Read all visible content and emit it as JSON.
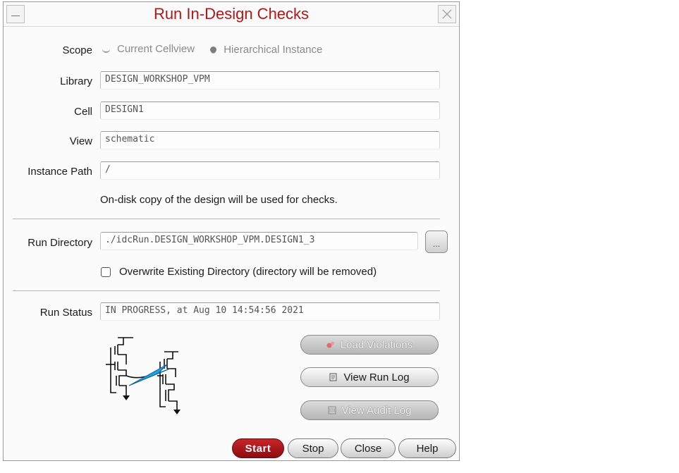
{
  "window": {
    "title": "Run In-Design Checks"
  },
  "scope": {
    "label": "Scope",
    "options": [
      {
        "label": "Current Cellview",
        "selected": false
      },
      {
        "label": "Hierarchical Instance",
        "selected": true
      }
    ]
  },
  "library": {
    "label": "Library",
    "value": "DESIGN_WORKSHOP_VPM"
  },
  "cell": {
    "label": "Cell",
    "value": "DESIGN1"
  },
  "view": {
    "label": "View",
    "value": "schematic"
  },
  "instance_path": {
    "label": "Instance Path",
    "value": "/"
  },
  "note": "On-disk copy of the design will be used for checks.",
  "run_directory": {
    "label": "Run Directory",
    "value": "./idcRun.DESIGN_WORKSHOP_VPM.DESIGN1_3",
    "browse_label": "..."
  },
  "overwrite": {
    "label": "Overwrite Existing Directory (directory will be removed)",
    "checked": false
  },
  "run_status": {
    "label": "Run Status",
    "value": "IN PROGRESS, at Aug 10 14:54:56 2021"
  },
  "actions": {
    "load_violations": "Load Violations",
    "view_run_log": "View Run Log",
    "view_audit_log": "View Audit Log"
  },
  "buttons": {
    "start": "Start",
    "stop": "Stop",
    "close": "Close",
    "help": "Help"
  },
  "colors": {
    "title": "#b01818",
    "primary_button": "#a8161b",
    "schematic_arrow": "#1ea0e6"
  }
}
